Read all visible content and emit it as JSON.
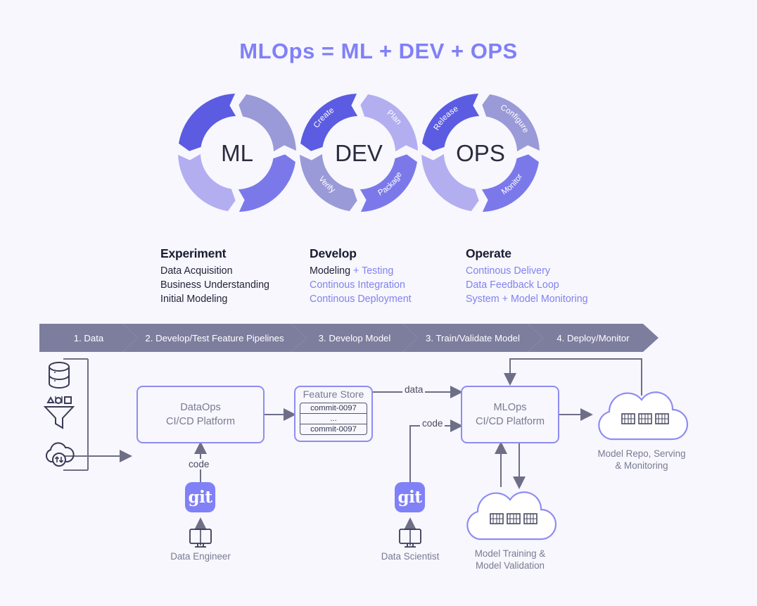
{
  "page": {
    "title": "MLOps = ML + DEV + OPS",
    "background": "#f7f7fd",
    "accent": "#8080f7",
    "ring_dark": "#5b5ce2",
    "ring_mid": "#7b79ea",
    "ring_light": "#b3aef0",
    "ring_gray": "#9b9ad8",
    "chevron_color": "#7d7e9e",
    "text_dark": "#1b1b33",
    "text_gray": "#7a7a93"
  },
  "rings": [
    {
      "name": "ML",
      "center_label": "ML",
      "segments": [
        {
          "label": "",
          "tone": "dark"
        },
        {
          "label": "",
          "tone": "gray"
        },
        {
          "label": "",
          "tone": "mid"
        },
        {
          "label": "",
          "tone": "light"
        }
      ]
    },
    {
      "name": "DEV",
      "center_label": "DEV",
      "segments": [
        {
          "label": "Create",
          "tone": "dark"
        },
        {
          "label": "Plan",
          "tone": "light"
        },
        {
          "label": "Package",
          "tone": "mid"
        },
        {
          "label": "Verify",
          "tone": "gray"
        }
      ]
    },
    {
      "name": "OPS",
      "center_label": "OPS",
      "segments": [
        {
          "label": "Release",
          "tone": "dark"
        },
        {
          "label": "Configure",
          "tone": "gray"
        },
        {
          "label": "Monitor",
          "tone": "mid"
        },
        {
          "label": "",
          "tone": "light"
        }
      ]
    }
  ],
  "columns": [
    {
      "heading": "Experiment",
      "lines": [
        {
          "text": "Data Acquisition",
          "accent": false
        },
        {
          "text": "Business Understanding",
          "accent": false
        },
        {
          "text": "Initial Modeling",
          "accent": false
        }
      ]
    },
    {
      "heading": "Develop",
      "lines": [
        {
          "text": "Modeling",
          "suffix": " + Testing",
          "accent": false,
          "suffix_accent": true
        },
        {
          "text": "Continous Integration",
          "accent": true
        },
        {
          "text": "Continous Deployment",
          "accent": true
        }
      ]
    },
    {
      "heading": "Operate",
      "lines": [
        {
          "text": "Continous Delivery",
          "accent": true
        },
        {
          "text": "Data Feedback Loop",
          "accent": true
        },
        {
          "text": "System + Model Monitoring",
          "accent": true
        }
      ]
    }
  ],
  "chevrons": [
    {
      "label": "1. Data"
    },
    {
      "label": "2. Develop/Test Feature Pipelines"
    },
    {
      "label": "3. Develop Model"
    },
    {
      "label": "3. Train/Validate Model"
    },
    {
      "label": "4. Deploy/Monitor"
    }
  ],
  "flow": {
    "sources": [
      {
        "icon": "database-icon"
      },
      {
        "icon": "funnel-filter-icon"
      },
      {
        "icon": "cloud-sync-icon"
      }
    ],
    "dataops_box": {
      "line1": "DataOps",
      "line2": "CI/CD Platform"
    },
    "mlops_box": {
      "line1": "MLOps",
      "line2": "CI/CD Platform"
    },
    "feature_store": {
      "title": "Feature Store",
      "rows": [
        "commit-0097",
        "...",
        "commit-0097"
      ]
    },
    "edge_labels": {
      "code_left": "code",
      "data": "data",
      "code_right": "code"
    },
    "git_badges": [
      {
        "label": "git",
        "actor": "Data Engineer"
      },
      {
        "label": "git",
        "actor": "Data Scientist"
      }
    ],
    "clouds": [
      {
        "caption_line1": "Model Repo, Serving",
        "caption_line2": "& Monitoring",
        "servers": 3
      },
      {
        "caption_line1": "Model Training &",
        "caption_line2": "Model Validation",
        "servers": 3
      }
    ]
  }
}
